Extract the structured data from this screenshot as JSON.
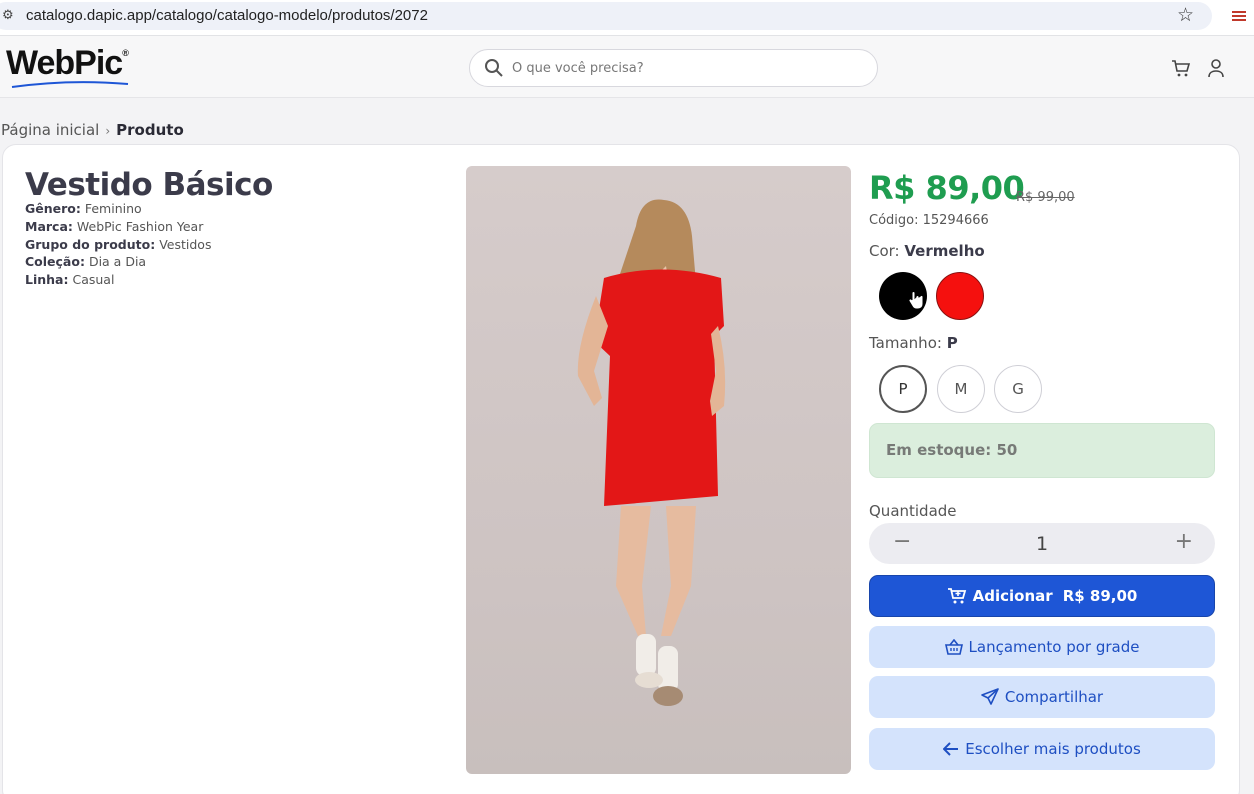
{
  "browser": {
    "url": "catalogo.dapic.app/catalogo/catalogo-modelo/produtos/2072"
  },
  "header": {
    "logo": "WebPic",
    "logo_mark": "®",
    "search_placeholder": "O que você precisa?"
  },
  "breadcrumb": {
    "home": "Página inicial",
    "separator": "›",
    "current": "Produto"
  },
  "product": {
    "name": "Vestido Básico",
    "specs": [
      {
        "label": "Gênero:",
        "value": "Feminino"
      },
      {
        "label": "Marca:",
        "value": "WebPic Fashion Year"
      },
      {
        "label": "Grupo do produto:",
        "value": "Vestidos"
      },
      {
        "label": "Coleção:",
        "value": "Dia a Dia"
      },
      {
        "label": "Linha:",
        "value": "Casual"
      }
    ],
    "price": "R$ 89,00",
    "old_price": "R$ 99,00",
    "code": "Código: 15294666",
    "color_label": "Cor:",
    "color_value": "Vermelho",
    "colors": [
      {
        "name": "Preto",
        "hex": "#000000"
      },
      {
        "name": "Vermelho",
        "hex": "#f5100e"
      }
    ],
    "size_label": "Tamanho:",
    "size_value": "P",
    "sizes": [
      "P",
      "M",
      "G"
    ],
    "stock": "Em estoque: 50",
    "quantity_label": "Quantidade",
    "quantity": "1",
    "quantity_minus": "−",
    "quantity_plus": "+"
  },
  "actions": {
    "add": "Adicionar",
    "add_price": "R$ 89,00",
    "grade": "Lançamento por grade",
    "share": "Compartilhar",
    "back": "Escolher mais produtos"
  },
  "colors": {
    "primary": "#1e56d6",
    "soft": "#d4e3fc",
    "price": "#1f9d50",
    "stock_bg": "#dbeedd"
  }
}
